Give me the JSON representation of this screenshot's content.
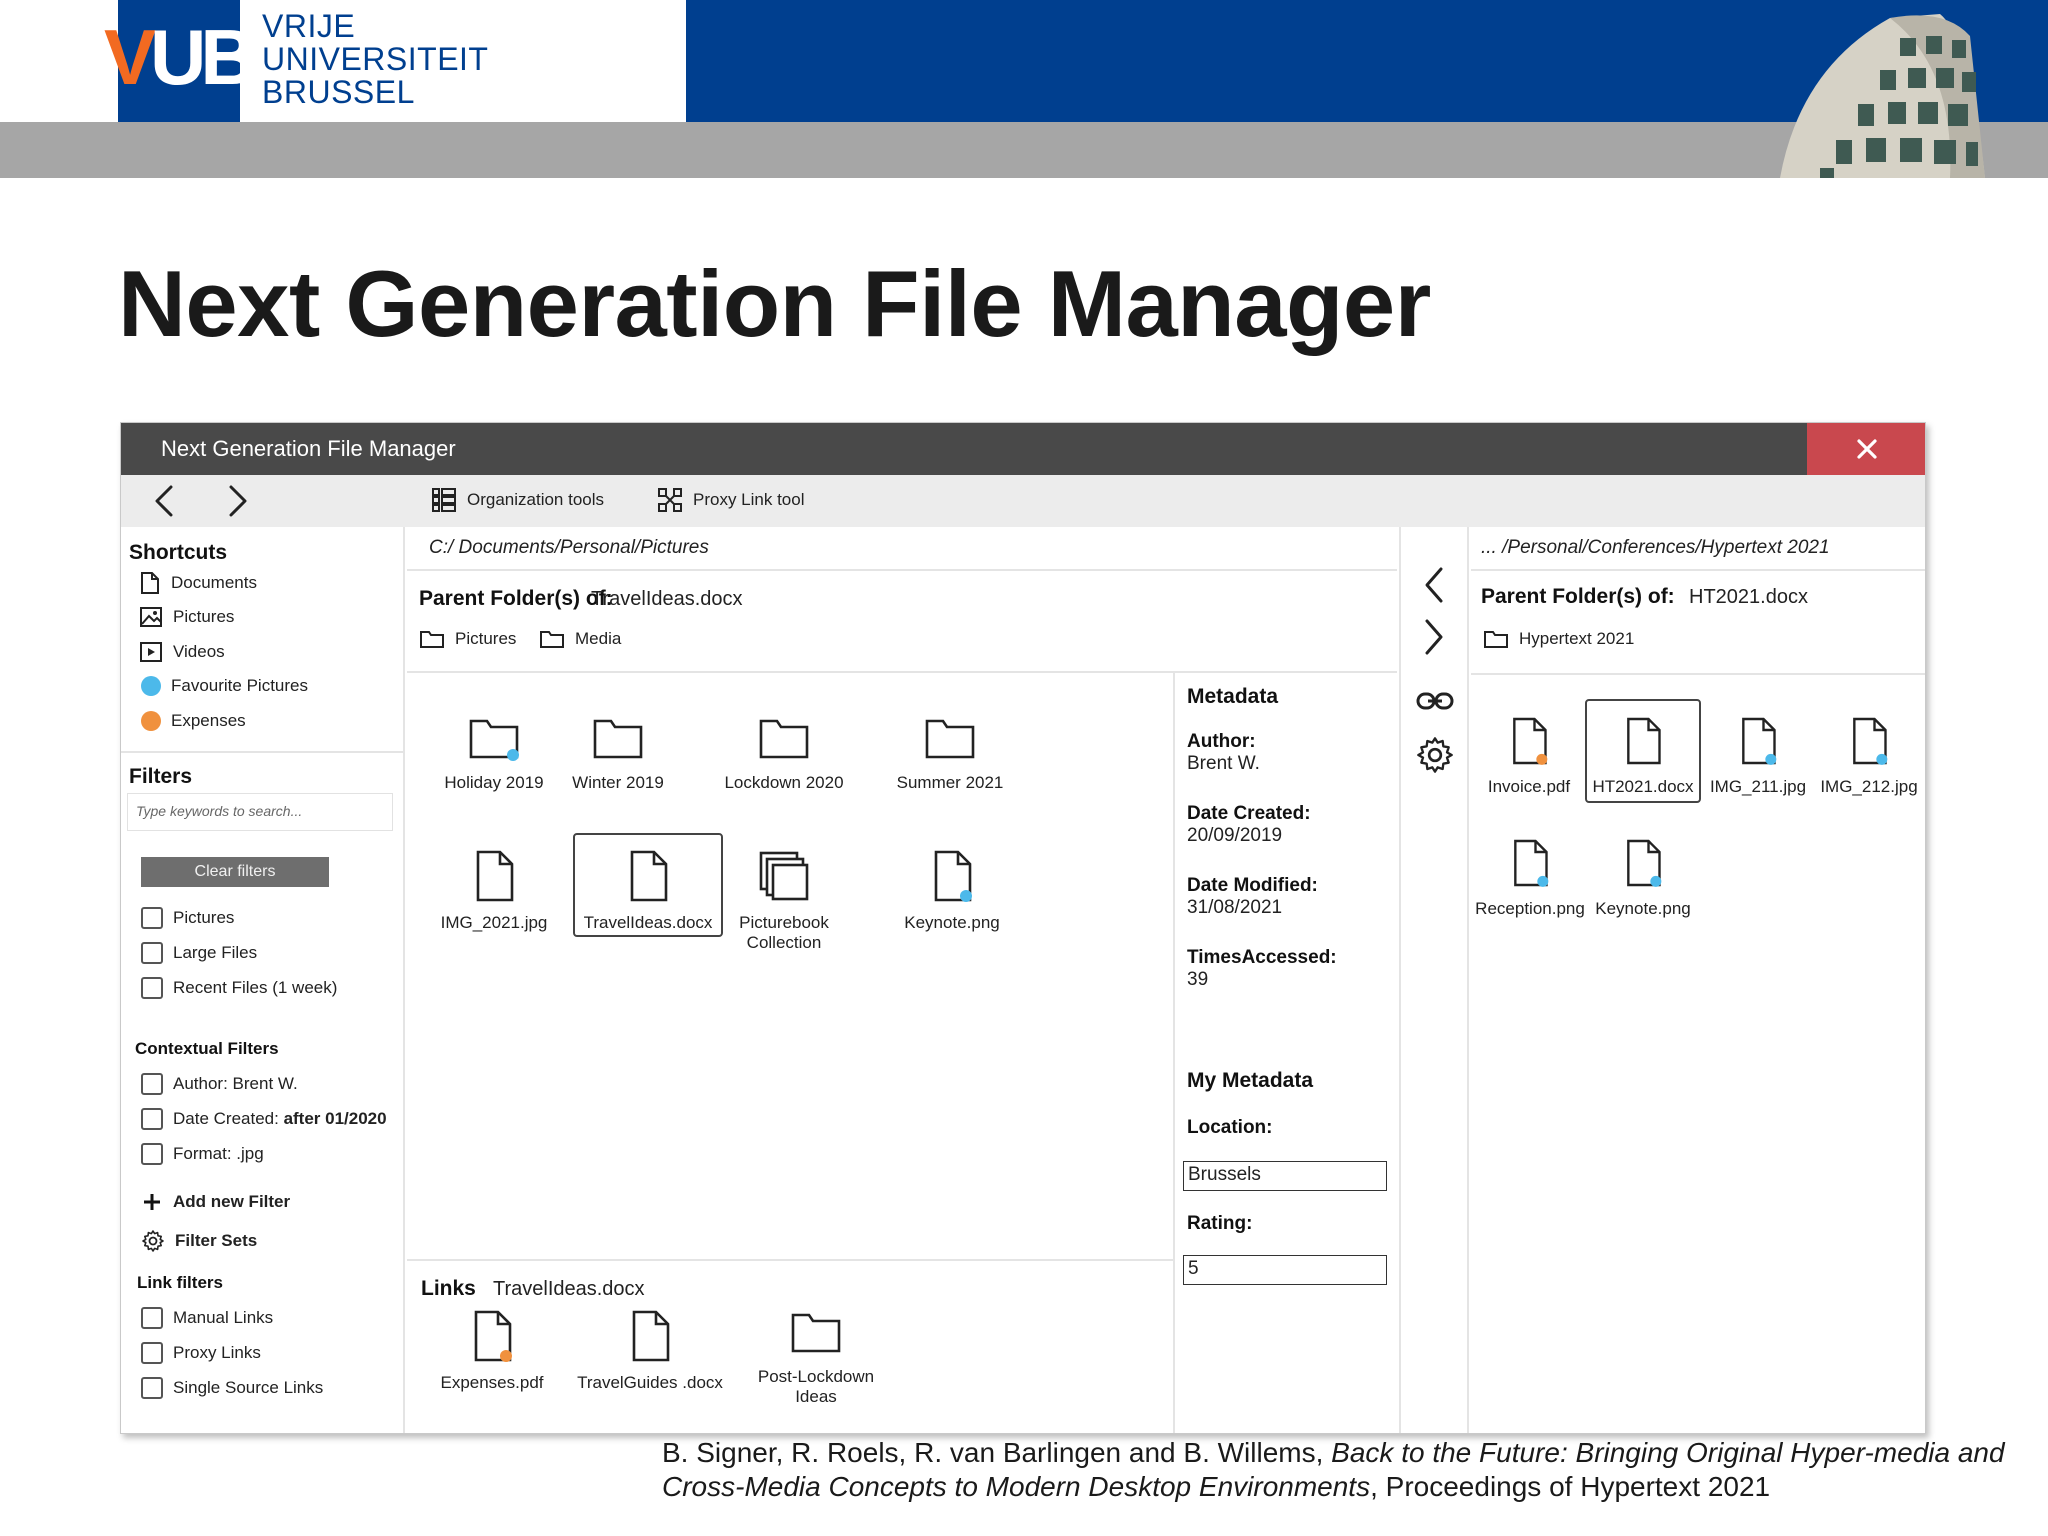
{
  "slide": {
    "logo_text": "VUB",
    "university_name": [
      "VRIJE",
      "UNIVERSITEIT",
      "BRUSSEL"
    ],
    "title": "Next Generation File Manager"
  },
  "window": {
    "title": "Next Generation File Manager",
    "close_symbol": "✕"
  },
  "toolbar": {
    "organization_tools": "Organization tools",
    "proxy_link_tool": "Proxy Link tool"
  },
  "sidebar": {
    "shortcuts_heading": "Shortcuts",
    "shortcuts": [
      {
        "label": "Documents",
        "icon": "document-icon"
      },
      {
        "label": "Pictures",
        "icon": "picture-icon"
      },
      {
        "label": "Videos",
        "icon": "video-icon"
      },
      {
        "label": "Favourite Pictures",
        "icon": "tag-dot",
        "color": "#4cb9ea"
      },
      {
        "label": "Expenses",
        "icon": "tag-dot",
        "color": "#f0913e"
      }
    ],
    "filters_heading": "Filters",
    "search_placeholder": "Type keywords to search...",
    "clear_filters": "Clear filters",
    "filters": [
      "Pictures",
      "Large Files",
      "Recent Files (1 week)"
    ],
    "contextual_heading": "Contextual Filters",
    "contextual": [
      {
        "label": "Author: Brent W.",
        "bold": ""
      },
      {
        "label": "Date Created: ",
        "bold": "after 01/2020"
      },
      {
        "label": "Format: .jpg",
        "bold": ""
      }
    ],
    "add_filter": "Add new Filter",
    "filter_sets": "Filter Sets",
    "link_filters_heading": "Link filters",
    "link_filters": [
      "Manual Links",
      "Proxy Links",
      "Single Source Links"
    ]
  },
  "main": {
    "path": "C:/ Documents/Personal/Pictures",
    "parent_label": "Parent Folder(s) of:",
    "parent_file": "TravelIdeas.docx",
    "parent_folders": [
      "Pictures",
      "Media"
    ],
    "items": [
      {
        "name": "Holiday 2019",
        "kind": "folder",
        "dot": "#4cb9ea"
      },
      {
        "name": "Winter 2019",
        "kind": "folder",
        "dot": ""
      },
      {
        "name": "Lockdown 2020",
        "kind": "folder",
        "dot": ""
      },
      {
        "name": "Summer 2021",
        "kind": "folder",
        "dot": ""
      },
      {
        "name": "IMG_2021.jpg",
        "kind": "file",
        "dot": ""
      },
      {
        "name": "TravelIdeas.docx",
        "kind": "file",
        "dot": "",
        "selected": true
      },
      {
        "name": "Picturebook Collection",
        "kind": "collection",
        "dot": ""
      },
      {
        "name": "Keynote.png",
        "kind": "file",
        "dot": "#4cb9ea"
      }
    ],
    "links_label": "Links",
    "links_file": "TravelIdeas.docx",
    "links": [
      {
        "name": "Expenses.pdf",
        "kind": "file",
        "dot": "#f0913e"
      },
      {
        "name": "TravelGuides .docx",
        "kind": "file",
        "dot": ""
      },
      {
        "name": "Post-Lockdown Ideas",
        "kind": "folder",
        "dot": ""
      }
    ]
  },
  "metadata": {
    "heading": "Metadata",
    "fields": [
      {
        "key": "Author:",
        "value": "Brent W."
      },
      {
        "key": "Date Created:",
        "value": "20/09/2019"
      },
      {
        "key": "Date Modified:",
        "value": "31/08/2021"
      },
      {
        "key": "TimesAccessed:",
        "value": "39"
      }
    ],
    "my_heading": "My Metadata",
    "location_label": "Location:",
    "location_value": "Brussels",
    "rating_label": "Rating:",
    "rating_value": "5"
  },
  "right": {
    "path": "... /Personal/Conferences/Hypertext 2021",
    "parent_label": "Parent Folder(s) of:",
    "parent_file": "HT2021.docx",
    "parent_folder": "Hypertext 2021",
    "items": [
      {
        "name": "Invoice.pdf",
        "dot": "#f0913e"
      },
      {
        "name": "HT2021.docx",
        "dot": "",
        "selected": true
      },
      {
        "name": "IMG_211.jpg",
        "dot": "#4cb9ea"
      },
      {
        "name": "IMG_212.jpg",
        "dot": "#4cb9ea"
      },
      {
        "name": "Reception.png",
        "dot": "#4cb9ea"
      },
      {
        "name": "Keynote.png",
        "dot": "#4cb9ea"
      }
    ]
  },
  "citation": {
    "authors": "B. Signer, R. Roels, R. van Barlingen and B. Willems, ",
    "title": "Back to the Future: Bringing Original Hyper-media and Cross-Media Concepts to Modern Desktop Environments",
    "venue": ", Proceedings of Hypertext 2021"
  },
  "colors": {
    "brand_blue": "#003f8f",
    "brand_orange": "#f26a21",
    "titlebar": "#494949",
    "close_red": "#c9484e",
    "tag_blue": "#4cb9ea",
    "tag_orange": "#f0913e"
  }
}
